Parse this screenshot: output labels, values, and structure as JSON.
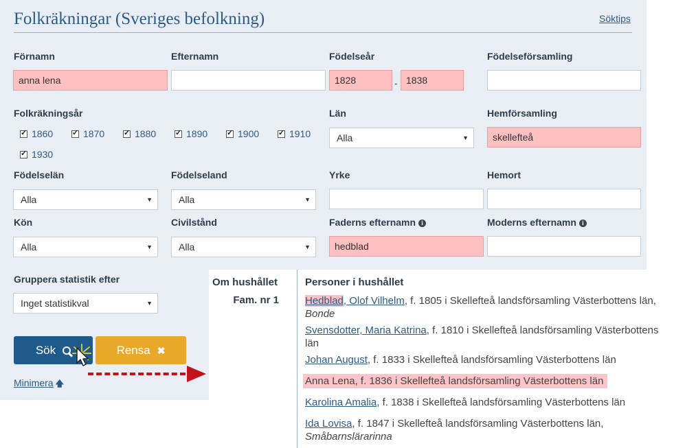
{
  "header": {
    "title": "Folkräkningar (Sveriges befolkning)",
    "tips_link": "Söktips"
  },
  "form": {
    "fornamn": {
      "label": "Förnamn",
      "value": "anna lena"
    },
    "efternamn": {
      "label": "Efternamn",
      "value": ""
    },
    "fodelsear": {
      "label": "Födelseår",
      "from": "1828",
      "separator": "-",
      "to": "1838"
    },
    "fodelseforsamling": {
      "label": "Födelseförsamling",
      "value": ""
    },
    "folkrakningsar": {
      "label": "Folkräkningsår",
      "years": [
        {
          "label": "1860",
          "checked": true
        },
        {
          "label": "1870",
          "checked": true
        },
        {
          "label": "1880",
          "checked": true
        },
        {
          "label": "1890",
          "checked": true
        },
        {
          "label": "1900",
          "checked": true
        },
        {
          "label": "1910",
          "checked": true
        },
        {
          "label": "1930",
          "checked": true
        }
      ]
    },
    "lan": {
      "label": "Län",
      "value": "Alla"
    },
    "hemforsamling": {
      "label": "Hemförsamling",
      "value": "skellefteå"
    },
    "fodelselan": {
      "label": "Födelselän",
      "value": "Alla"
    },
    "fodelseland": {
      "label": "Födelseland",
      "value": "Alla"
    },
    "yrke": {
      "label": "Yrke",
      "value": ""
    },
    "hemort": {
      "label": "Hemort",
      "value": ""
    },
    "kon": {
      "label": "Kön",
      "value": "Alla"
    },
    "civilstand": {
      "label": "Civilstånd",
      "value": "Alla"
    },
    "faderns_efternamn": {
      "label": "Faderns efternamn",
      "value": "hedblad"
    },
    "moderns_efternamn": {
      "label": "Moderns efternamn",
      "value": ""
    },
    "gruppera": {
      "label": "Gruppera statistik efter",
      "value": "Inget statistikval"
    }
  },
  "buttons": {
    "search": "Sök",
    "reset": "Rensa",
    "minimize": "Minimera"
  },
  "household": {
    "header": "Om hushållet",
    "fam": "Fam. nr 1",
    "persons_header": "Personer i hushållet",
    "persons": [
      {
        "surname": "Hedblad",
        "rest_name": ", Olof Vilhelm",
        "info": ", f. 1805 i Skellefteå landsförsamling Västerbottens län,",
        "occupation": "Bonde"
      },
      {
        "name": "Svensdotter, Maria Katrina",
        "info": ", f. 1810 i Skellefteå landsförsamling Västerbottens län"
      },
      {
        "name": "Johan August",
        "info": ", f. 1833 i Skellefteå landsförsamling Västerbottens län"
      },
      {
        "name": "Anna Lena",
        "info": ", f. 1836 i Skellefteå landsförsamling Västerbottens län"
      },
      {
        "name": "Karolina Amalia",
        "info": ", f. 1838 i Skellefteå landsförsamling Västerbottens län"
      },
      {
        "name": "Ida Lovisa",
        "info": ", f. 1847 i Skellefteå landsförsamling Västerbottens län,",
        "occupation": "Småbarnslärarinna"
      }
    ]
  },
  "colors": {
    "accent": "#1f5a8b",
    "reset": "#e8a82a",
    "highlight": "#ffc0c2",
    "arrow": "#c0141a",
    "panel": "#e8eef4"
  }
}
